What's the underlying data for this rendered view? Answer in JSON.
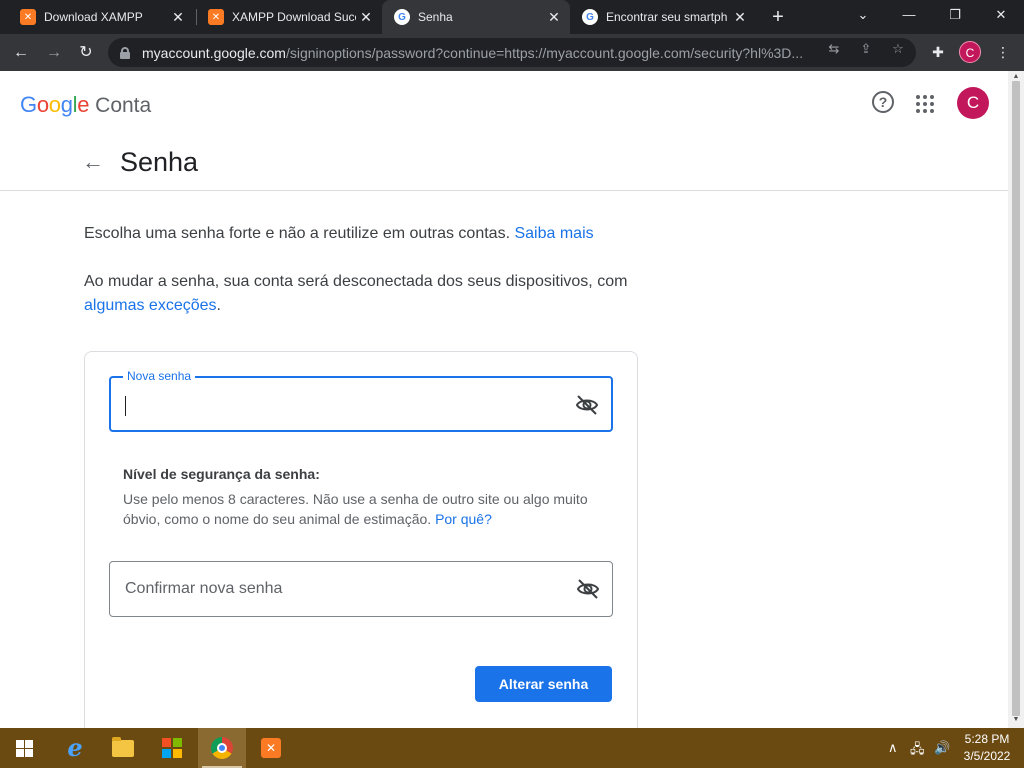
{
  "browser": {
    "tabs": [
      {
        "title": "Download XAMPP",
        "favicon": "xampp-icon"
      },
      {
        "title": "XAMPP Download Succ",
        "favicon": "xampp-icon"
      },
      {
        "title": "Senha",
        "favicon": "google-icon",
        "active": true
      },
      {
        "title": "Encontrar seu smartph",
        "favicon": "google-icon"
      }
    ],
    "url_host": "myaccount.google.com",
    "url_path": "/signinoptions/password?continue=https://myaccount.google.com/security?hl%3D...",
    "profile_initial": "C"
  },
  "header": {
    "logo_google": [
      "G",
      "o",
      "o",
      "g",
      "l",
      "e"
    ],
    "logo_colors": [
      "#4285f4",
      "#ea4335",
      "#fbbc05",
      "#4285f4",
      "#34a853",
      "#ea4335"
    ],
    "product": "Conta",
    "help_glyph": "?",
    "avatar_initial": "C",
    "avatar_color": "#c2185b"
  },
  "page": {
    "title": "Senha",
    "intro_text": "Escolha uma senha forte e não a reutilize em outras contas.",
    "intro_link": "Saiba mais",
    "warning_text": "Ao mudar a senha, sua conta será desconectada dos seus dispositivos, com",
    "warning_link": "algumas exceções",
    "warning_end": "."
  },
  "form": {
    "new_password_label": "Nova senha",
    "new_password_value": "",
    "strength_title": "Nível de segurança da senha:",
    "strength_text": "Use pelo menos 8 caracteres. Não use a senha de outro site ou algo muito óbvio, como o nome do seu animal de estimação.",
    "strength_link": "Por quê?",
    "confirm_placeholder": "Confirmar nova senha",
    "submit_label": "Alterar senha",
    "accent_color": "#1a73e8"
  },
  "taskbar": {
    "apps": [
      "windows-start",
      "internet-explorer",
      "file-explorer",
      "microsoft-store",
      "chrome",
      "xampp"
    ],
    "time": "5:28 PM",
    "date": "3/5/2022"
  }
}
